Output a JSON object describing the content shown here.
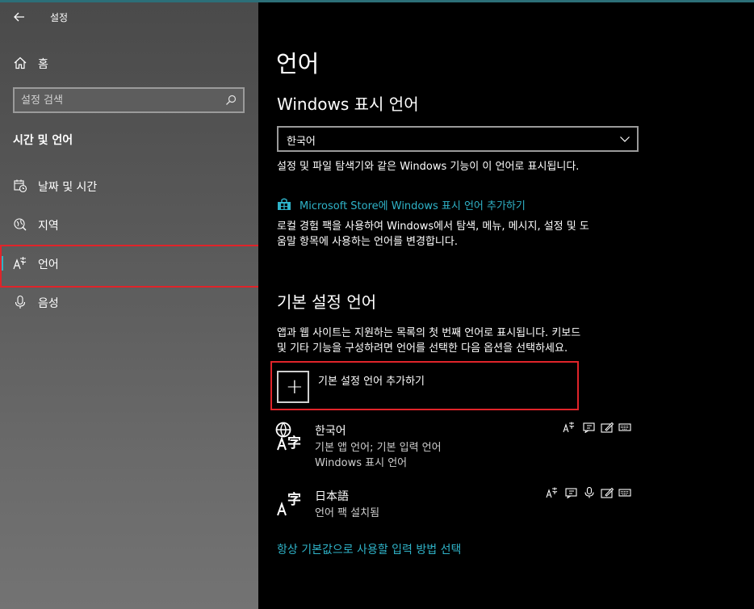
{
  "window": {
    "title": "설정"
  },
  "sidebar": {
    "home_label": "홈",
    "search_placeholder": "설정 검색",
    "section_title": "시간 및 언어",
    "items": [
      {
        "label": "날짜 및 시간",
        "icon": "calendar-clock-icon"
      },
      {
        "label": "지역",
        "icon": "globe-region-icon"
      },
      {
        "label": "언어",
        "icon": "language-icon",
        "selected": true
      },
      {
        "label": "음성",
        "icon": "microphone-icon"
      }
    ]
  },
  "main": {
    "page_title": "언어",
    "display_language": {
      "heading": "Windows 표시 언어",
      "selected_value": "한국어",
      "description": "설정 및 파일 탐색기와 같은 Windows 기능이 이 언어로 표시됩니다.",
      "store_link": "Microsoft Store에 Windows 표시 언어 추가하기",
      "store_desc_line1": "로컬 경험 팩을 사용하여 Windows에서 탐색, 메뉴, 메시지, 설정 및 도",
      "store_desc_line2": "움말 항목에 사용하는 언어를 변경합니다."
    },
    "preferred": {
      "heading": "기본 설정 언어",
      "desc_line1": "앱과 웹 사이트는 지원하는 목록의 첫 번째 언어로 표시됩니다. 키보드",
      "desc_line2": "및 기타 기능을 구성하려면 언어를 선택한 다음 옵션을 선택하세요.",
      "add_label": "기본 설정 언어 추가하기",
      "languages": [
        {
          "name": "한국어",
          "line1": "기본 앱 언어; 기본 입력 언어",
          "line2": "Windows 표시 언어"
        },
        {
          "name": "日本語",
          "line1": "언어 팩 설치됨"
        }
      ]
    },
    "bottom_link": "항상 기본값으로 사용할 입력 방법 선택"
  },
  "colors": {
    "accent": "#2fb3c8",
    "highlight_box": "#e0242a",
    "selection_bar": "#34b0c4"
  }
}
